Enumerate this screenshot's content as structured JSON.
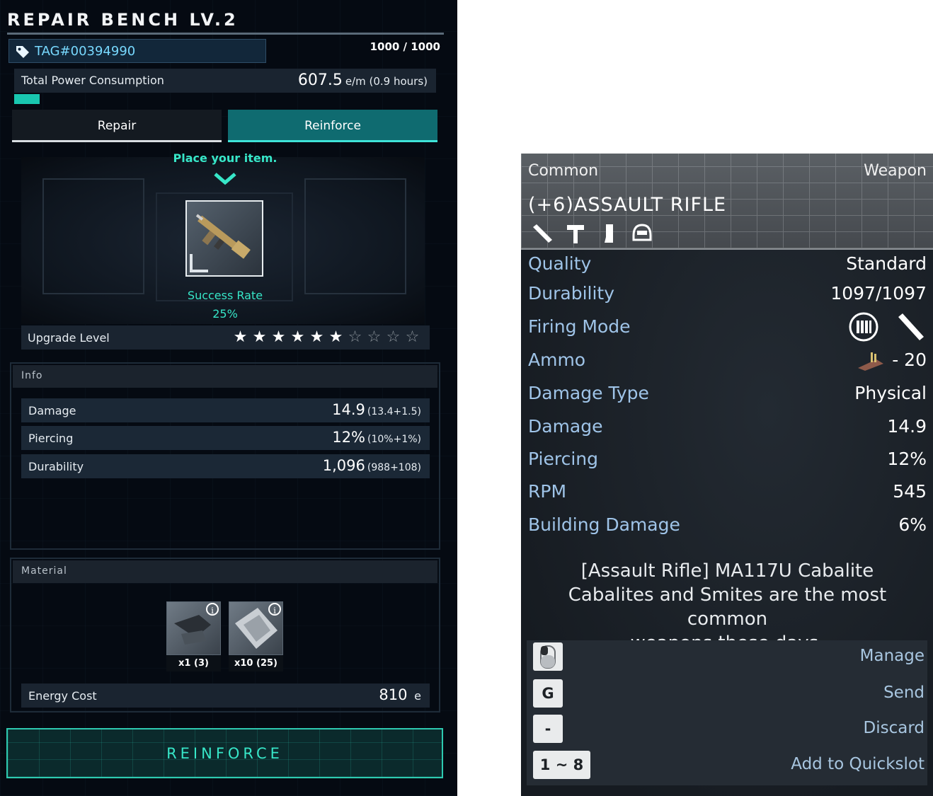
{
  "bench": {
    "title": "REPAIR BENCH LV.2",
    "tag": "TAG#00394990",
    "capacity": "1000 / 1000",
    "power_label": "Total Power Consumption",
    "power_value": "607.5",
    "power_unit": "e/m (0.9 hours)",
    "power_bar_fraction": 0.06,
    "tabs": [
      {
        "label": "Repair",
        "active": false
      },
      {
        "label": "Reinforce",
        "active": true
      }
    ],
    "place_item": "Place your item.",
    "success_label": "Success Rate",
    "success_value": "25%",
    "upgrade_label": "Upgrade Level",
    "upgrade_stars_filled": 6,
    "upgrade_stars_total": 10,
    "info_header": "Info",
    "stats": [
      {
        "label": "Damage",
        "value": "14.9",
        "detail": "(13.4+1.5)"
      },
      {
        "label": "Piercing",
        "value": "12%",
        "detail": "(10%+1%)"
      },
      {
        "label": "Durability",
        "value": "1,096",
        "detail": "(988+108)"
      }
    ],
    "material_header": "Material",
    "materials": [
      {
        "qty": "x1 (3)",
        "info_icon": "info-icon"
      },
      {
        "qty": "x10 (25)",
        "info_icon": "info-icon"
      }
    ],
    "energy_label": "Energy Cost",
    "energy_value": "810",
    "energy_unit": "e",
    "reinforce_button": "REINFORCE",
    "accent_color": "#37e6c8"
  },
  "tooltip": {
    "rarity": "Common",
    "type": "Weapon",
    "name": "(+6)ASSAULT RIFLE",
    "header_icons": [
      "knife-icon",
      "hammer-icon",
      "stock-icon",
      "helmet-icon"
    ],
    "stats": [
      {
        "label": "Quality",
        "value": "Standard"
      },
      {
        "label": "Durability",
        "value": "1097/1097"
      },
      {
        "label": "Firing Mode",
        "value": "",
        "icons": [
          "auto-fire-icon",
          "single-shot-icon"
        ]
      },
      {
        "label": "Ammo",
        "value": "- 20",
        "icons": [
          "ammo-icon"
        ]
      },
      {
        "label": "Damage Type",
        "value": "Physical"
      },
      {
        "label": "Damage",
        "value": "14.9"
      },
      {
        "label": "Piercing",
        "value": "12%"
      },
      {
        "label": "RPM",
        "value": "545"
      },
      {
        "label": "Building Damage",
        "value": "6%"
      }
    ],
    "description": [
      "[Assault Rifle] MA117U Cabalite",
      "Cabalites and Smites are the most common",
      "weapons these days."
    ],
    "keys": [
      {
        "key": "",
        "key_icon": "mouse-icon",
        "action": "Manage"
      },
      {
        "key": "G",
        "action": "Send"
      },
      {
        "key": "-",
        "action": "Discard"
      },
      {
        "key": "1 ~ 8",
        "action": "Add to Quickslot"
      }
    ]
  }
}
